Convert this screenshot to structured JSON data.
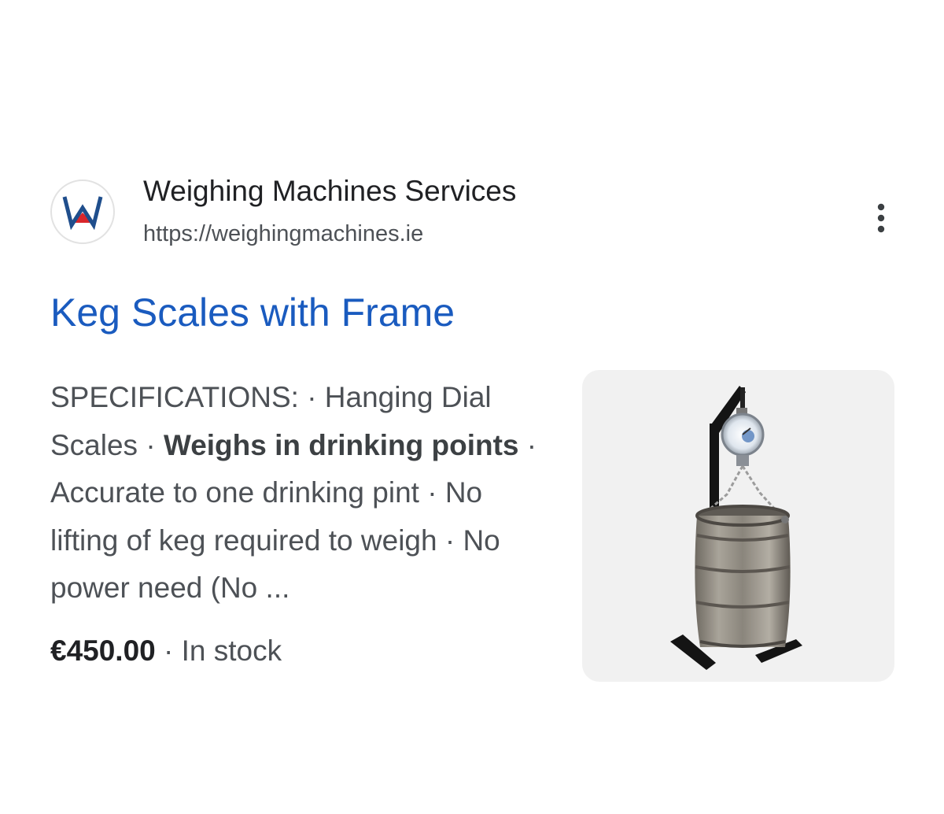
{
  "result": {
    "site_name": "Weighing Machines Services",
    "site_url": "https://weighingmachines.ie",
    "logo_letter": "W",
    "more_icon": "more-vert-icon",
    "title": "Keg Scales with Frame",
    "snippet": {
      "part1": "SPECIFICATIONS: · Hanging Dial Scales · ",
      "bold1": "Weighs in drinking points",
      "part2": " · Accurate to one drinking pint · No lifting of keg required to weigh · No power need (No ..."
    },
    "price": "€450.00",
    "separator": " · ",
    "availability": "In stock",
    "thumbnail": "keg-scale-with-frame",
    "colors": {
      "title": "#1a5bbf",
      "text": "#4d5156",
      "logo_red": "#d9262b",
      "logo_blue": "#1f4e8c"
    }
  }
}
